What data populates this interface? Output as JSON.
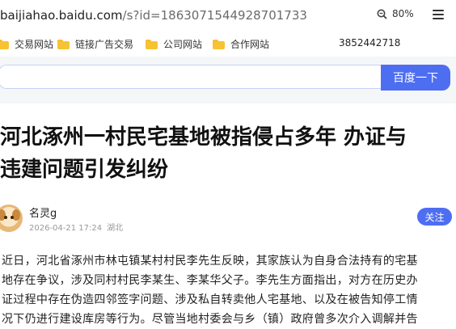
{
  "address_bar": {
    "host": "baijiahao.baidu.com",
    "path": "/s?id=1863071544928701733",
    "zoom": "80%"
  },
  "bookmarks": {
    "items": [
      {
        "label": "交易网站",
        "icon": "folder-icon"
      },
      {
        "label": "链接广告交易",
        "icon": "folder-icon"
      },
      {
        "label": "公司网站",
        "icon": "folder-icon"
      },
      {
        "label": "合作网站",
        "icon": "folder-icon"
      }
    ],
    "phone": "3852442718"
  },
  "search": {
    "value": "",
    "button_label": "百度一下",
    "accent_color": "#4e6ef2"
  },
  "article": {
    "title_line1": "河北涿州一村民宅基地被指侵占多年 办证与",
    "title_line2": "违建问题引发纠纷",
    "author": "名灵g",
    "date": "2026-04-21 17:24",
    "location": "湖北",
    "follow_label": "关注",
    "paragraph_lines": [
      "近日，河北省涿州市林屯镇某村村民李先生反映，其家族认为自身合法持有的宅基",
      "地存在争议，涉及同村村民李某生、李某华父子。李先生方面指出，对方在历史办",
      "证过程中存在伪造四邻签字问题、涉及私自转卖他人宅基地、以及在被告知停工情",
      "况下仍进行建设库房等行为。尽管当地村委会与乡（镇）政府曾多次介入调解并告"
    ]
  }
}
